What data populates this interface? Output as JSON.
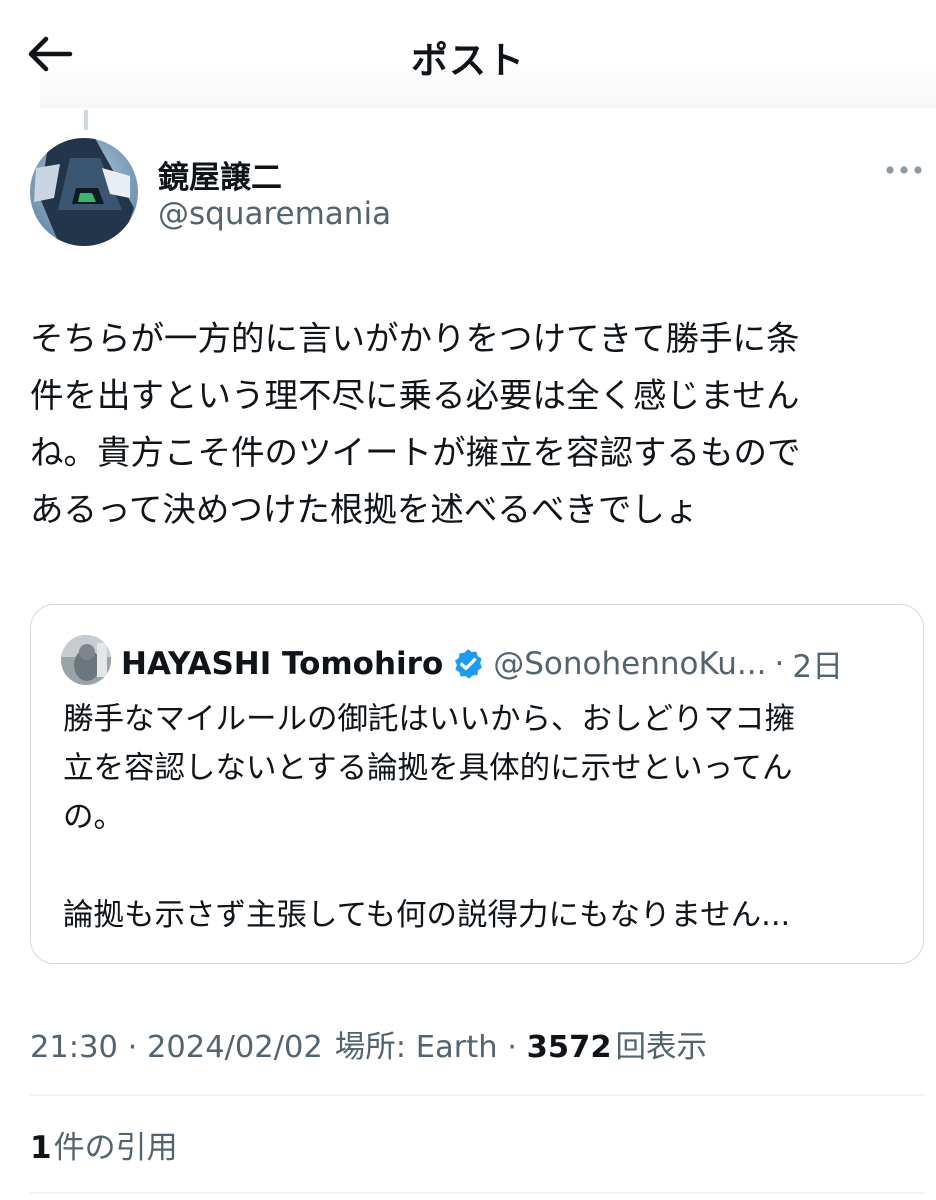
{
  "header": {
    "title": "ポスト",
    "back_icon": "arrow-left-icon"
  },
  "post": {
    "author": {
      "display_name": "鏡屋譲二",
      "handle": "@squaremania"
    },
    "more_icon": "more-horizontal-icon",
    "text": "そちらが一方的に言いがかりをつけてきて勝手に条\n件を出すという理不尽に乗る必要は全く感じません\nね。貴方こそ件のツイートが擁立を容認するもので\nあるって決めつけた根拠を述べるべきでしょ",
    "quoted": {
      "display_name": "HAYASHI Tomohiro",
      "verified_icon": "verified-badge-icon",
      "handle": "@SonohennoKu...",
      "separator": "·",
      "time": "2日",
      "text": "勝手なマイルールの御託はいいから、おしどりマコ擁\n立を容認しないとする論拠を具体的に示せといってん\nの。\n\n論拠も示さず主張しても何の説得力にもなりません..."
    },
    "meta": {
      "time": "21:30",
      "date": "2024/02/02",
      "location": "場所: Earth",
      "separator": " · ",
      "views_count": "3572",
      "views_label": "回表示"
    },
    "quotes": {
      "count": "1",
      "label": "件の引用"
    }
  },
  "colors": {
    "text_primary": "#0f1419",
    "text_secondary": "#536471",
    "border": "#cfd9de",
    "verified_blue": "#1d9bf0"
  }
}
